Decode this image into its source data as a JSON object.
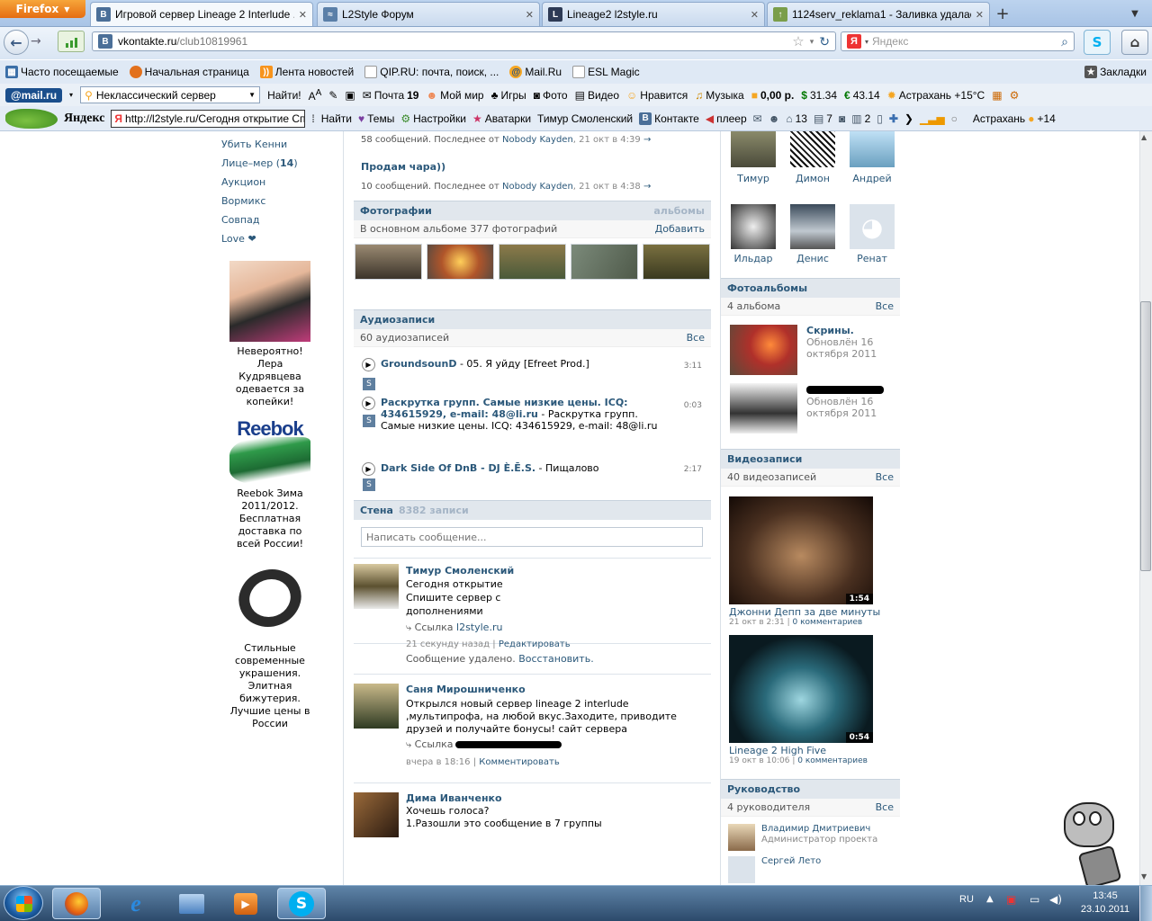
{
  "browser": {
    "app_button": "Firefox",
    "tabs": [
      {
        "title": "Игровой сервер Lineage 2 Interlude ...",
        "icon": "vk-icon"
      },
      {
        "title": "L2Style Форум",
        "icon": "l2-icon"
      },
      {
        "title": "Lineage2 l2style.ru",
        "icon": "l2-icon"
      },
      {
        "title": "1124serv_reklama1 - Заливка удалас...",
        "icon": "upload-icon"
      }
    ],
    "url_domain": "vkontakte.ru",
    "url_path": "/club10819961",
    "search_placeholder": "Яндекс",
    "search_engine": "Я"
  },
  "bookmarks": {
    "items": [
      "Часто посещаемые",
      "Начальная страница",
      "Лента новостей",
      "QIP.RU: почта, поиск, ...",
      "Mail.Ru",
      "ESL Magic"
    ],
    "right": "Закладки"
  },
  "mailbar": {
    "logo": "@mail.ru",
    "search_value": "Неклассический сервер",
    "find": "Найти!",
    "mail": "Почта",
    "mail_count": "19",
    "moymir": "Мой мир",
    "games": "Игры",
    "photo": "Фото",
    "video": "Видео",
    "like": "Нравится",
    "music": "Музыка",
    "balance": "0,00 р.",
    "usd": "31.34",
    "eur": "43.14",
    "weather": "Астрахань +15°C"
  },
  "yabar": {
    "logo": "Яндекс",
    "input": "http://l2style.ru/Сегодня открытие Спи",
    "find": "Найти",
    "themes": "Темы",
    "settings": "Настройки",
    "avatars": "Аватарки",
    "user": "Тимур Смоленский",
    "contact": "Контакте",
    "player": "плеер",
    "c1": "13",
    "c2": "7",
    "c3": "2",
    "weather": "Астрахань",
    "temp": "+14"
  },
  "left_menu": [
    "Убить Кенни",
    "Лице–мер",
    "Аукцион",
    "Вормикс",
    "Совпад",
    "Love ❤"
  ],
  "left_menu_count": "14",
  "ads": [
    {
      "text": "Невероятно! Лера Кудрявцева одевается за копейки!"
    },
    {
      "brand": "Reebok",
      "text": "Reebok Зима 2011/2012. Бесплатная доставка по всей России!"
    },
    {
      "text": "Стильные современные украшения. Элитная бижутерия. Лучшие цены в России"
    }
  ],
  "topics": [
    {
      "title": "",
      "meta": "58 сообщений. Последнее от",
      "author": "Nobody Kayden",
      "date": ", 21 окт в 4:39"
    },
    {
      "title": "Продам чара))",
      "meta": "10 сообщений. Последнее от",
      "author": "Nobody Kayden",
      "date": ", 21 окт в 4:38"
    }
  ],
  "photos": {
    "head": "Фотографии",
    "right": "альбомы",
    "sub": "В основном альбоме 377 фотографий",
    "add": "Добавить"
  },
  "audio": {
    "head": "Аудиозаписи",
    "sub": "60 аудиозаписей",
    "all": "Все",
    "tracks": [
      {
        "artist": "GroundsounD",
        "title": " - 05. Я уйду [Efreet Prod.]",
        "time": "3:11"
      },
      {
        "artist": "Раскрутка групп. Самые низкие цены. ICQ: 434615929, e-mail: 48@li.ru",
        "title": " - Раскрутка групп. Самые низкие цены. ICQ: 434615929, e-mail: 48@li.ru",
        "time": "0:03"
      },
      {
        "artist": "Dark Side Of DnB - DJ È.Ē.S.",
        "title": " - Пищалово",
        "time": "2:17"
      }
    ]
  },
  "wall": {
    "head": "Стена",
    "count": "8382 записи",
    "placeholder": "Написать сообщение...",
    "posts": [
      {
        "author": "Тимур Смоленский",
        "text": "Сегодня открытие Спишите сервер с дополнениями",
        "link_label": "Ссылка",
        "link": "l2style.ru",
        "time": "21 секунду назад",
        "action": "Редактировать"
      },
      {
        "author": "Саня Мирошниченко",
        "text": "Открылся новый сервер lineage 2 interlude ,мультипрофа, на любой вкус.Заходите, приводите друзей и получайте бонусы! сайт сервера",
        "link_label": "Ссылка",
        "time": "вчера в 18:16",
        "action": "Комментировать"
      },
      {
        "author": "Дима Иванченко",
        "text": "Хочешь голоса?",
        "text2": "1.Разошли это сообщение в 7 группы"
      }
    ],
    "deleted": "Сообщение удалено.",
    "restore": "Восстановить."
  },
  "members": [
    "Тимур",
    "Димон",
    "Андрей",
    "Ильдар",
    "Денис",
    "Ренат"
  ],
  "albums": {
    "head": "Фотоальбомы",
    "sub": "4 альбома",
    "all": "Все",
    "items": [
      {
        "title": "Скрины.",
        "updated": "Обновлён 16 октября 2011"
      },
      {
        "title": "",
        "updated": "Обновлён 16 октября 2011"
      }
    ]
  },
  "videos": {
    "head": "Видеозаписи",
    "sub": "40 видеозаписей",
    "all": "Все",
    "items": [
      {
        "title": "Джонни Депп за две минуты",
        "duration": "1:54",
        "date": "21 окт в 2:31",
        "comments": "0 комментариев"
      },
      {
        "title": "Lineage 2 High Five",
        "duration": "0:54",
        "date": "19 окт в 10:06",
        "comments": "0 комментариев"
      }
    ]
  },
  "leaders": {
    "head": "Руководство",
    "sub": "4 руководителя",
    "all": "Все",
    "items": [
      {
        "name": "Владимир Дмитриевич",
        "role": "Администратор проекта"
      },
      {
        "name": "Сергей Лето",
        "role": ""
      }
    ]
  },
  "taskbar": {
    "lang": "RU",
    "time": "13:45",
    "date": "23.10.2011"
  }
}
